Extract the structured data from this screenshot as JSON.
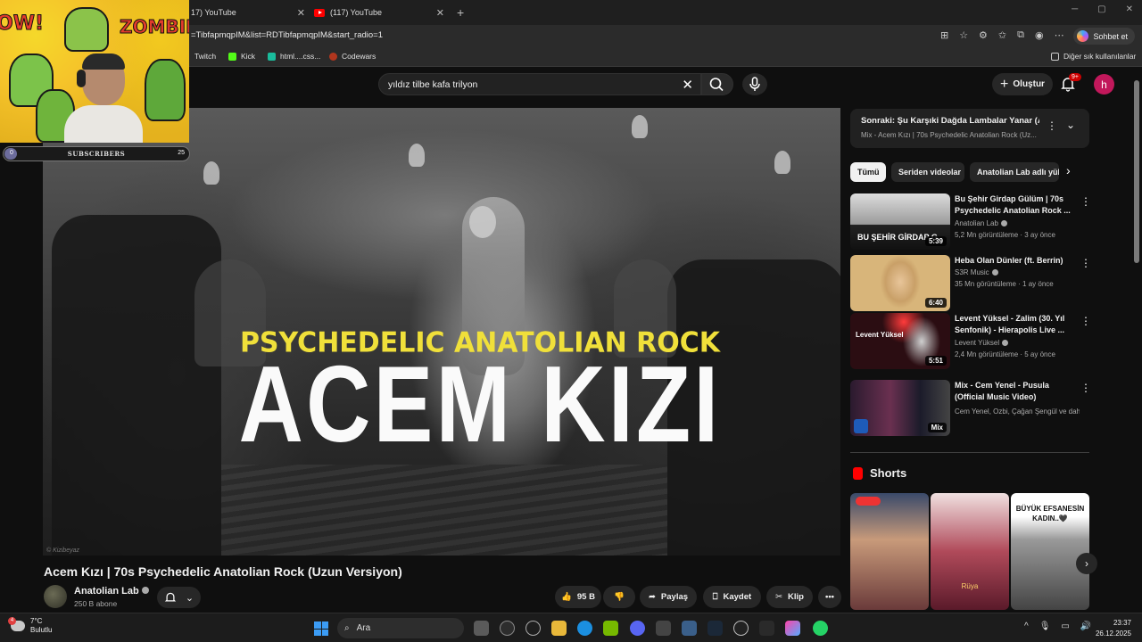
{
  "browser": {
    "tabs": [
      {
        "title": "17) YouTube"
      },
      {
        "title": "(117) YouTube"
      }
    ],
    "url": "=TibfapmqpIM&list=RDTibfapmqpIM&start_radio=1",
    "copilot_label": "Sohbet et",
    "bookmarks": [
      {
        "label": "Twitch",
        "color": "#9146ff"
      },
      {
        "label": "Kick",
        "color": "#53fc18"
      },
      {
        "label": "html....css...",
        "color": "#1abc9c"
      },
      {
        "label": "Codewars",
        "color": "#b1361e"
      }
    ],
    "other_bookmarks": "Diğer sık kullanılanlar"
  },
  "youtube": {
    "search_query": "yıldız tilbe kafa trilyon",
    "create_label": "Oluştur",
    "notif_badge": "9+",
    "avatar_letter": "h",
    "video": {
      "overlay_subtitle": "PSYCHEDELIC ANATOLIAN ROCK",
      "overlay_title": "ACEM KIZI",
      "watermark": "© Kizibeyaz",
      "title": "Acem Kızı | 70s Psychedelic Anatolian Rock (Uzun Versiyon)",
      "channel": "Anatolian Lab",
      "subscribers": "250 B abone",
      "likes": "95 B",
      "share_label": "Paylaş",
      "save_label": "Kaydet",
      "clip_label": "Klip"
    },
    "mix_panel": {
      "title": "Sonraki: Şu Karşıki Dağda Lambalar Yanar (A...",
      "subtitle": "Mix - Acem Kızı | 70s Psychedelic Anatolian Rock (Uz..."
    },
    "chips": [
      {
        "label": "Tümü",
        "active": true
      },
      {
        "label": "Seriden videolar",
        "active": false
      },
      {
        "label": "Anatolian Lab adlı yük",
        "active": false
      }
    ],
    "recommendations": [
      {
        "title": "Bu Şehir Girdap Gülüm | 70s Psychedelic Anatolian Rock ...",
        "channel": "Anatolian Lab",
        "verified": true,
        "meta": "5,2 Mn görüntüleme · 3 ay önce",
        "duration": "5:39",
        "thumb_text": "BU ŞEHİR GİRDAP G"
      },
      {
        "title": "Heba Olan Dünler (ft. Berrin)",
        "channel": "S3R Music",
        "verified": true,
        "meta": "35 Mn görüntüleme · 1 ay önce",
        "duration": "6:40",
        "thumb_text": ""
      },
      {
        "title": "Levent Yüksel - Zalim (30. Yıl Senfonik) - Hierapolis Live ...",
        "channel": "Levent Yüksel",
        "verified": true,
        "meta": "2,4 Mn görüntüleme · 5 ay önce",
        "duration": "5:51",
        "thumb_text": "Levent Yüksel"
      },
      {
        "title": "Mix - Cem Yenel - Pusula (Official Music Video)",
        "channel": "Cem Yenel, Ozbi, Çağan Şengül ve daha f...",
        "verified": false,
        "meta": "",
        "duration": "Mix",
        "thumb_text": ""
      }
    ],
    "shorts_title": "Shorts",
    "shorts": [
      {
        "caption": ""
      },
      {
        "caption": "Rüya"
      },
      {
        "caption": "BÜYÜK EFSANESİN KADIN..🖤"
      }
    ]
  },
  "stream_overlay": {
    "top_left_text": "OW!",
    "top_right_text": "ZOMBIE!",
    "subscriber_goal_label": "SUBSCRIBERS",
    "goal_current": "0",
    "goal_target": "25",
    "goal_progress": 0.0
  },
  "taskbar": {
    "weather_temp": "7°C",
    "weather_desc": "Bulutlu",
    "weather_badge": "4",
    "search_label": "Ara",
    "time": "23:37",
    "date": "26.12.2025"
  }
}
